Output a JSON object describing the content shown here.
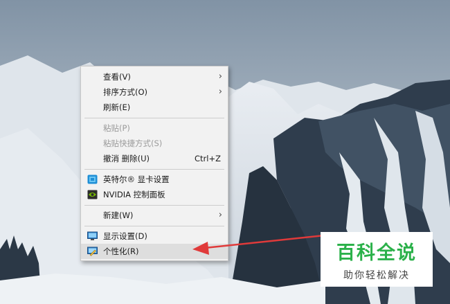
{
  "context_menu": {
    "items": [
      {
        "label": "查看(V)",
        "has_submenu": true
      },
      {
        "label": "排序方式(O)",
        "has_submenu": true
      },
      {
        "label": "刷新(E)"
      },
      {
        "label": "粘贴(P)",
        "disabled": true
      },
      {
        "label": "粘贴快捷方式(S)",
        "disabled": true
      },
      {
        "label": "撤消 删除(U)",
        "shortcut": "Ctrl+Z"
      },
      {
        "label": "英特尔® 显卡设置",
        "icon": "intel-graphics-icon"
      },
      {
        "label": "NVIDIA 控制面板",
        "icon": "nvidia-icon"
      },
      {
        "label": "新建(W)",
        "has_submenu": true
      },
      {
        "label": "显示设置(D)",
        "icon": "display-icon"
      },
      {
        "label": "个性化(R)",
        "icon": "personalize-icon",
        "highlighted": true
      }
    ],
    "submenu_glyph": "›"
  },
  "watermark": {
    "title": "百科全说",
    "subtitle": "助你轻松解决"
  },
  "colors": {
    "menu_bg": "#f2f2f2",
    "highlight_bg": "#dedede",
    "arrow_red": "#e03a3a",
    "brand_green": "#2bb14a"
  }
}
